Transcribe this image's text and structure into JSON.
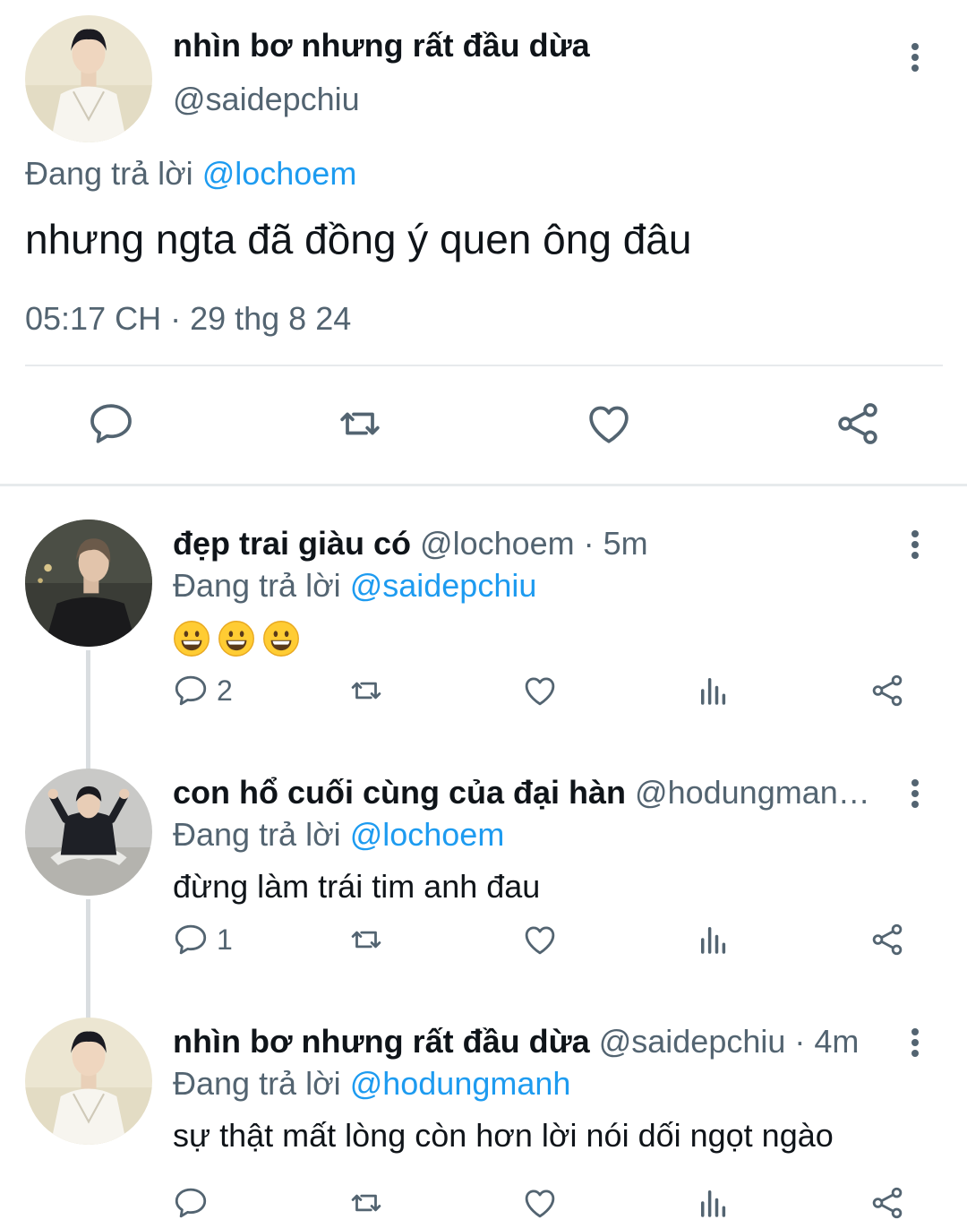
{
  "main_tweet": {
    "display_name": "nhìn bơ nhưng rất đầu dừa",
    "handle": "@saidepchiu",
    "replying_prefix": "Đang trả lời ",
    "replying_to": "@lochoem",
    "text": "nhưng ngta đã đồng ý quen ông đâu",
    "timestamp": "05:17 CH · 29 thg 8 24",
    "actions": [
      "reply-icon",
      "retweet-icon",
      "like-icon",
      "share-icon"
    ]
  },
  "replies": [
    {
      "display_name": "đẹp trai giàu có",
      "handle_time": " @lochoem · 5m",
      "replying_prefix": "Đang trả lời ",
      "replying_to": "@saidepchiu",
      "text": "😀😀😀",
      "reply_count": "2"
    },
    {
      "display_name": "con hổ cuối cùng của đại hàn",
      "handle_time": " @hodungman…",
      "replying_prefix": "Đang trả lời ",
      "replying_to": "@lochoem",
      "text": "đừng làm trái tim anh đau",
      "reply_count": "1"
    },
    {
      "display_name": "nhìn bơ nhưng rất đầu dừa",
      "handle_time": " @saidepchiu · 4m",
      "replying_prefix": "Đang trả lời ",
      "replying_to": "@hodungmanh",
      "text": "sự thật mất lòng còn hơn lời nói dối ngọt ngào",
      "reply_count": ""
    }
  ],
  "colors": {
    "text": "#0f1419",
    "secondary": "#536471",
    "accent": "#1d9bf0",
    "divider": "#e7eaec"
  }
}
